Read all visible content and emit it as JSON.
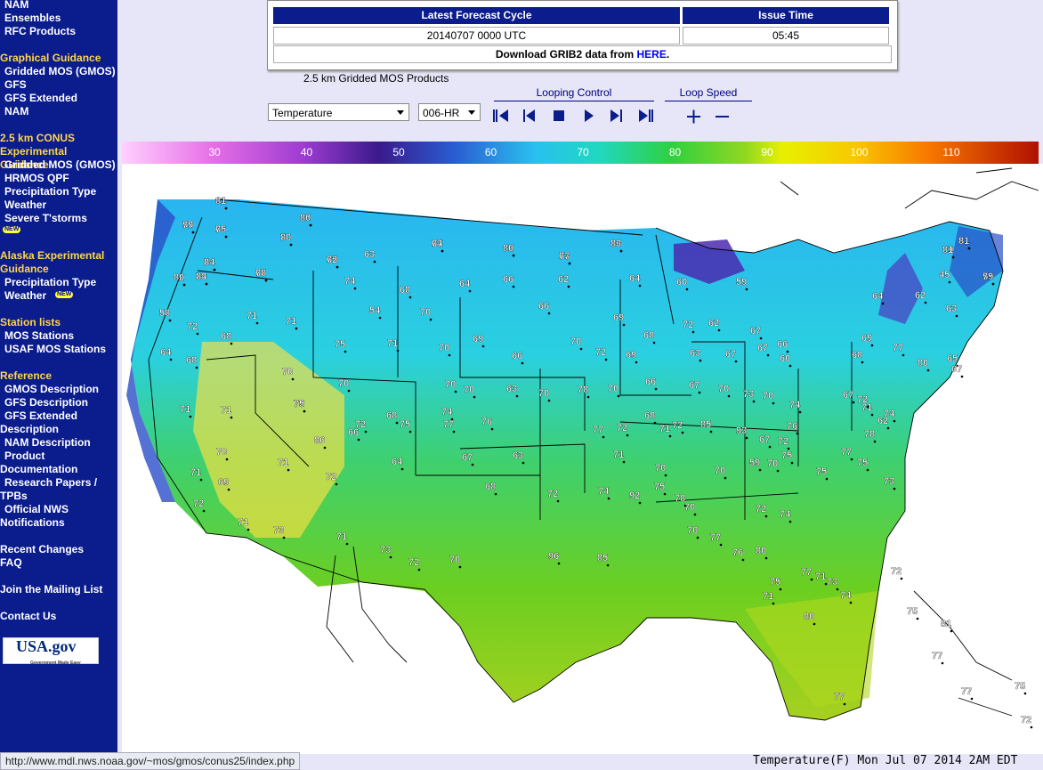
{
  "sidebar": {
    "top_items": [
      "NAM",
      "Ensembles",
      "RFC Products"
    ],
    "graphical_title": "Graphical Guidance",
    "graphical_items": [
      "Gridded MOS (GMOS)",
      "GFS",
      "GFS Extended",
      "NAM"
    ],
    "conus_title": "2.5 km CONUS Experimental Guidance",
    "conus_items": [
      "Gridded MOS (GMOS)",
      "HRMOS QPF",
      "Precipitation Type",
      "Weather",
      "Severe T'storms"
    ],
    "new_badge": "NEW",
    "alaska_title": "Alaska Experimental Guidance",
    "alaska_items": [
      "Precipitation Type",
      "Weather"
    ],
    "station_title": "Station lists",
    "station_items": [
      "MOS Stations",
      "USAF MOS Stations"
    ],
    "reference_title": "Reference",
    "reference_items": [
      "GMOS Description",
      "GFS Description",
      "GFS Extended Description",
      "NAM Description",
      "Product Documentation",
      "Research Papers / TPBs",
      "Official NWS Notifications"
    ],
    "recent_changes": "Recent Changes",
    "faq": "FAQ",
    "mailing_list": "Join the Mailing List",
    "contact": "Contact Us",
    "usagov_text": "USA.gov",
    "usagov_sub": "Government Made Easy"
  },
  "cycle_table": {
    "col1_header": "Latest Forecast Cycle",
    "col2_header": "Issue Time",
    "cycle_value": "20140707  0000 UTC",
    "issue_time": "05:45",
    "download_prefix": "Download GRIB2 data from ",
    "download_link": "HERE",
    "download_suffix": "."
  },
  "products_label": "2.5 km Gridded MOS Products",
  "controls": {
    "element_select": "Temperature",
    "hour_select": "006-HR",
    "looping_label": "Looping Control",
    "speed_label": "Loop Speed"
  },
  "colorbar": {
    "ticks": [
      "30",
      "40",
      "50",
      "60",
      "70",
      "80",
      "90",
      "100",
      "110"
    ]
  },
  "map": {
    "values": [
      "61",
      "65",
      "59",
      "66",
      "70",
      "67",
      "62",
      "63",
      "60",
      "61",
      "59",
      "55",
      "62",
      "70",
      "74",
      "67",
      "65",
      "63",
      "74",
      "68",
      "64",
      "66",
      "62",
      "64",
      "60",
      "59",
      "64",
      "62",
      "45",
      "63",
      "58",
      "72",
      "71",
      "71",
      "54",
      "70",
      "66",
      "69",
      "68",
      "62",
      "67",
      "72",
      "66",
      "64",
      "68",
      "68",
      "75",
      "71",
      "70",
      "69",
      "66",
      "70",
      "72",
      "69",
      "63",
      "67",
      "67",
      "60",
      "80",
      "77",
      "69",
      "68",
      "65",
      "67",
      "70",
      "70",
      "73",
      "70",
      "70",
      "63",
      "70",
      "78",
      "70",
      "66",
      "67",
      "70",
      "73",
      "70",
      "74",
      "67",
      "72",
      "71",
      "74",
      "62",
      "78",
      "71",
      "71",
      "75",
      "74",
      "68",
      "72",
      "66",
      "86",
      "75",
      "77",
      "76",
      "77",
      "72",
      "68",
      "71",
      "72",
      "85",
      "93",
      "67",
      "72",
      "76",
      "70",
      "71",
      "64",
      "67",
      "63",
      "71",
      "70",
      "70",
      "59",
      "70",
      "75",
      "75",
      "77",
      "75",
      "73",
      "71",
      "69",
      "72",
      "68",
      "72",
      "74",
      "92",
      "75",
      "78",
      "70",
      "72",
      "74",
      "72",
      "71",
      "73",
      "71",
      "73",
      "72",
      "70",
      "96",
      "85",
      "70",
      "77",
      "76",
      "80",
      "75",
      "77",
      "71",
      "73",
      "71",
      "80",
      "74",
      "72",
      "75",
      "81",
      "77",
      "77",
      "75",
      "72",
      "77",
      "81",
      "80",
      "77",
      "75",
      "80",
      "74",
      "80",
      "77",
      "83",
      "81",
      "81",
      "79",
      "80",
      "84",
      "84",
      "78",
      "72"
    ],
    "footer": "Temperature(F)  Mon Jul 07 2014  2AM EDT"
  },
  "status_url": "http://www.mdl.nws.noaa.gov/~mos/gmos/conus25/index.php",
  "colors": {
    "sidebar_bg": "#0b1c8c",
    "section_title": "#ffd44a",
    "header_bg": "#0b1c8c",
    "page_bg": "#e6e6f8"
  }
}
